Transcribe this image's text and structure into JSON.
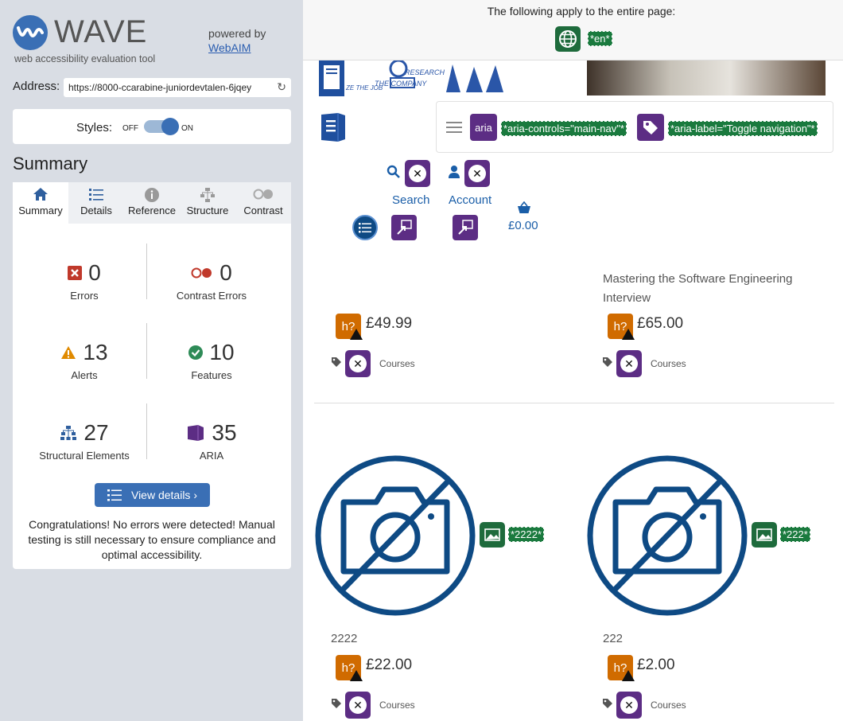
{
  "sidebar": {
    "logo_text": "WAVE",
    "tagline": "web accessibility evaluation tool",
    "powered_by": "powered by",
    "webaim_link": "WebAIM",
    "address_label": "Address:",
    "address_value": "https://8000-ccarabine-juniordevtalen-6jqey",
    "styles_label": "Styles:",
    "styles_off": "OFF",
    "styles_on": "ON",
    "summary_heading": "Summary",
    "tabs": [
      {
        "label": "Summary",
        "icon": "home-icon"
      },
      {
        "label": "Details",
        "icon": "list-icon"
      },
      {
        "label": "Reference",
        "icon": "info-icon"
      },
      {
        "label": "Structure",
        "icon": "structure-icon"
      },
      {
        "label": "Contrast",
        "icon": "contrast-icon"
      }
    ],
    "stats": {
      "errors": {
        "count": "0",
        "label": "Errors"
      },
      "contrast_errors": {
        "count": "0",
        "label": "Contrast Errors"
      },
      "alerts": {
        "count": "13",
        "label": "Alerts"
      },
      "features": {
        "count": "10",
        "label": "Features"
      },
      "structural": {
        "count": "27",
        "label": "Structural Elements"
      },
      "aria": {
        "count": "35",
        "label": "ARIA"
      }
    },
    "view_details": "View details ›",
    "congrats": "Congratulations! No errors were detected! Manual testing is still necessary to ensure compliance and optimal accessibility."
  },
  "main": {
    "page_notice": "The following apply to the entire page:",
    "lang_tag": "*en*",
    "aria_icon_text": "aria",
    "aria_controls": "*aria-controls=\"main-nav\"*",
    "aria_label": "*aria-label=\"Toggle navigation\"*",
    "hero_text_1": "RESEARCH",
    "hero_text_2": "THE COMPANY",
    "hero_text_3": "ZE THE JOB",
    "search_label": "Search",
    "account_label": "Account",
    "basket_total": "£0.00",
    "products": [
      {
        "title": "",
        "price": "£49.99",
        "category": "Courses"
      },
      {
        "title": "Mastering the Software Engineering Interview",
        "price": "£65.00",
        "category": "Courses"
      },
      {
        "title": "2222",
        "price": "£22.00",
        "category": "Courses",
        "alt_tag": "*2222*"
      },
      {
        "title": "222",
        "price": "£2.00",
        "category": "Courses",
        "alt_tag": "*222*"
      }
    ],
    "h_icon_text": "h?"
  },
  "colors": {
    "wave_blue": "#3a6fb5",
    "error_red": "#c0392b",
    "alert_orange": "#e08a00",
    "feature_green": "#2e8b57",
    "aria_purple": "#5c2d84",
    "tag_green": "#1a7a3e",
    "placeholder_blue": "#0e4a84"
  }
}
